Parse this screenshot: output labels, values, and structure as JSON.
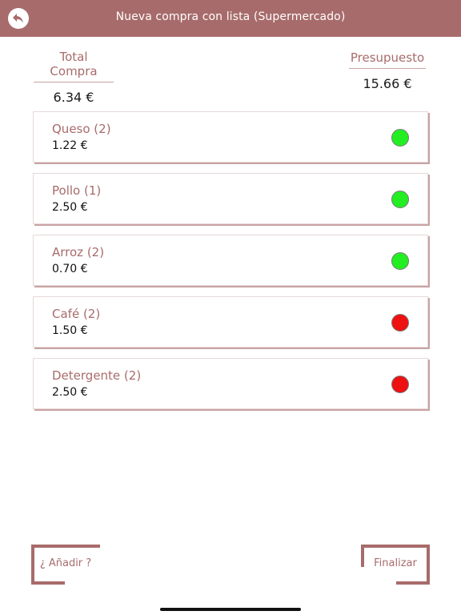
{
  "header": {
    "title": "Nueva compra con lista (Supermercado)",
    "back_icon": "back-arrow-icon"
  },
  "summary": {
    "total_label": "Total Compra",
    "total_value": "6.34 €",
    "budget_label": "Presupuesto",
    "budget_value": "15.66 €"
  },
  "items": [
    {
      "name": "Queso (2)",
      "price": "1.22 €",
      "status_color": "#22ee22"
    },
    {
      "name": "Pollo (1)",
      "price": "2.50 €",
      "status_color": "#22ee22"
    },
    {
      "name": "Arroz (2)",
      "price": "0.70 €",
      "status_color": "#22ee22"
    },
    {
      "name": "Café (2)",
      "price": "1.50 €",
      "status_color": "#ee1111"
    },
    {
      "name": "Detergente (2)",
      "price": "2.50 €",
      "status_color": "#ee1111"
    }
  ],
  "actions": {
    "add_label": "¿ Añadir ?",
    "finish_label": "Finalizar"
  },
  "colors": {
    "accent": "#a86b6b",
    "in_budget": "#22ee22",
    "over_budget": "#ee1111"
  }
}
